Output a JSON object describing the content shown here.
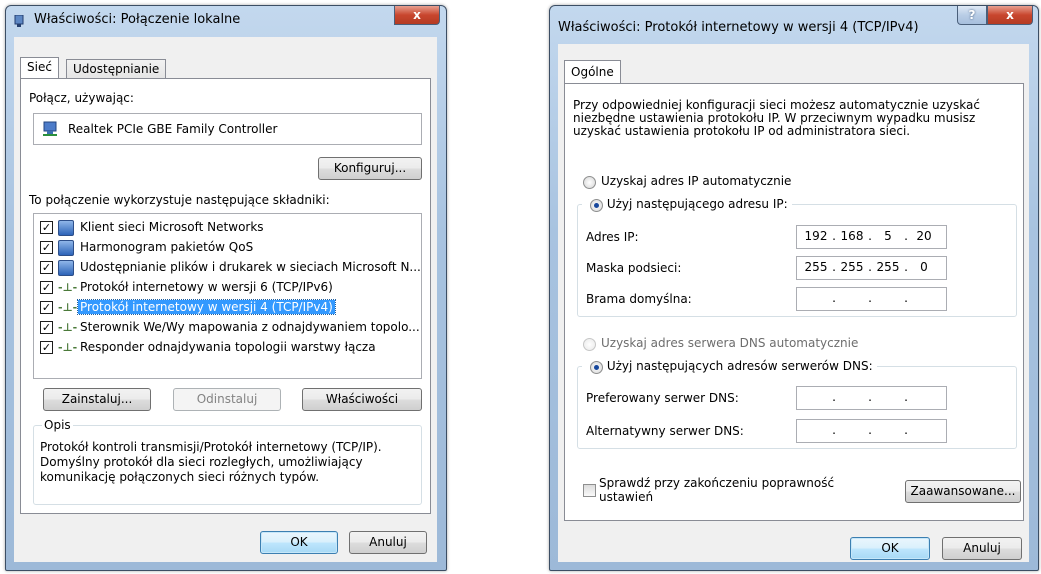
{
  "left": {
    "title": "Właściwości: Połączenie lokalne",
    "close_glyph": "x",
    "tabs": [
      "Sieć",
      "Udostępnianie"
    ],
    "connect_using_label": "Połącz, używając:",
    "adapter": "Realtek PCIe GBE Family Controller",
    "configure_button": "Konfiguruj...",
    "components_label": "To połączenie wykorzystuje następujące składniki:",
    "components": [
      {
        "checked": true,
        "icon": "network-client-icon",
        "label": "Klient sieci Microsoft Networks"
      },
      {
        "checked": true,
        "icon": "network-service-icon",
        "label": "Harmonogram pakietów QoS"
      },
      {
        "checked": true,
        "icon": "network-service-icon",
        "label": "Udostępnianie plików i drukarek w sieciach Microsoft N..."
      },
      {
        "checked": true,
        "icon": "protocol-icon",
        "label": "Protokół internetowy w wersji 6 (TCP/IPv6)"
      },
      {
        "checked": true,
        "icon": "protocol-icon",
        "label": "Protokół internetowy w wersji 4 (TCP/IPv4)",
        "selected": true
      },
      {
        "checked": true,
        "icon": "protocol-icon",
        "label": "Sterownik We/Wy mapowania z odnajdywaniem topolo..."
      },
      {
        "checked": true,
        "icon": "protocol-icon",
        "label": "Responder odnajdywania topologii warstwy łącza"
      }
    ],
    "install_button": "Zainstaluj...",
    "uninstall_button": "Odinstaluj",
    "properties_button": "Właściwości",
    "description_title": "Opis",
    "description_lines": [
      "Protokół kontroli transmisji/Protokół internetowy (TCP/IP).",
      "Domyślny protokół dla sieci rozległych, umożliwiający",
      "komunikację połączonych sieci różnych typów."
    ],
    "ok_button": "OK",
    "cancel_button": "Anuluj"
  },
  "right": {
    "title": "Właściwości: Protokół internetowy w wersji 4 (TCP/IPv4)",
    "help_glyph": "?",
    "close_glyph": "x",
    "tab": "Ogólne",
    "intro_lines": [
      "Przy odpowiedniej konfiguracji sieci możesz automatycznie uzyskać",
      "niezbędne ustawienia protokołu IP. W przeciwnym wypadku musisz",
      "uzyskać ustawienia protokołu IP od administratora sieci."
    ],
    "ip_auto": "Uzyskaj adres IP automatycznie",
    "ip_manual": "Użyj następującego adresu IP:",
    "ip_address_label": "Adres IP:",
    "ip_address": [
      "192",
      "168",
      "5",
      "20"
    ],
    "subnet_label": "Maska podsieci:",
    "subnet": [
      "255",
      "255",
      "255",
      "0"
    ],
    "gateway_label": "Brama domyślna:",
    "gateway": [
      "",
      "",
      "",
      ""
    ],
    "dns_auto": "Uzyskaj adres serwera DNS automatycznie",
    "dns_manual": "Użyj następujących adresów serwerów DNS:",
    "preferred_dns_label": "Preferowany serwer DNS:",
    "preferred_dns": [
      "",
      "",
      "",
      ""
    ],
    "alternate_dns_label": "Alternatywny serwer DNS:",
    "alternate_dns": [
      "",
      "",
      "",
      ""
    ],
    "validate_line1": "Sprawdź przy zakończeniu poprawność",
    "validate_line2": "ustawień",
    "validate_checked": false,
    "advanced_button": "Zaawansowane...",
    "ok_button": "OK",
    "cancel_button": "Anuluj"
  },
  "colors": {
    "selection": "#3399ff",
    "client_bg": "#f0f0f0",
    "frame": "#a8c3e0"
  }
}
